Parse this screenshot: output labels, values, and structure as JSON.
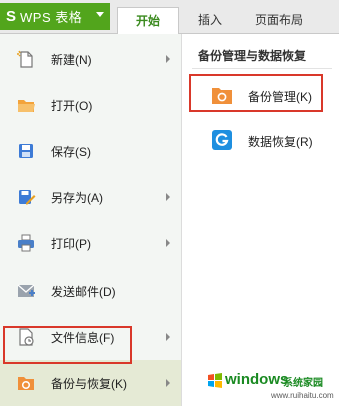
{
  "app": {
    "logo": "S",
    "name": "WPS 表格"
  },
  "tabs": [
    {
      "label": "开始",
      "active": true
    },
    {
      "label": "插入",
      "active": false
    },
    {
      "label": "页面布局",
      "active": false
    }
  ],
  "menu": {
    "items": [
      {
        "label": "新建(N)",
        "icon": "new-file-icon",
        "has_submenu": true
      },
      {
        "label": "打开(O)",
        "icon": "open-folder-icon",
        "has_submenu": false
      },
      {
        "label": "保存(S)",
        "icon": "save-icon",
        "has_submenu": false
      },
      {
        "label": "另存为(A)",
        "icon": "save-as-icon",
        "has_submenu": true
      },
      {
        "label": "打印(P)",
        "icon": "print-icon",
        "has_submenu": true
      },
      {
        "label": "发送邮件(D)",
        "icon": "mail-icon",
        "has_submenu": false
      },
      {
        "label": "文件信息(F)",
        "icon": "file-info-icon",
        "has_submenu": true
      },
      {
        "label": "备份与恢复(K)",
        "icon": "backup-icon",
        "has_submenu": true,
        "selected": true
      }
    ]
  },
  "submenu": {
    "title": "备份管理与数据恢复",
    "items": [
      {
        "label": "备份管理(K)",
        "icon": "backup-management-icon"
      },
      {
        "label": "数据恢复(R)",
        "icon": "data-recovery-icon"
      }
    ]
  },
  "watermark": {
    "brand": "windows",
    "suffix": "系统家园",
    "url": "www.ruihaitu.com"
  },
  "colors": {
    "wps_green": "#52a51c",
    "highlight_red": "#d9382a",
    "tab_active_text": "#3a8a1e",
    "folder_orange": "#f0903a",
    "recovery_blue": "#1e8fe0"
  }
}
